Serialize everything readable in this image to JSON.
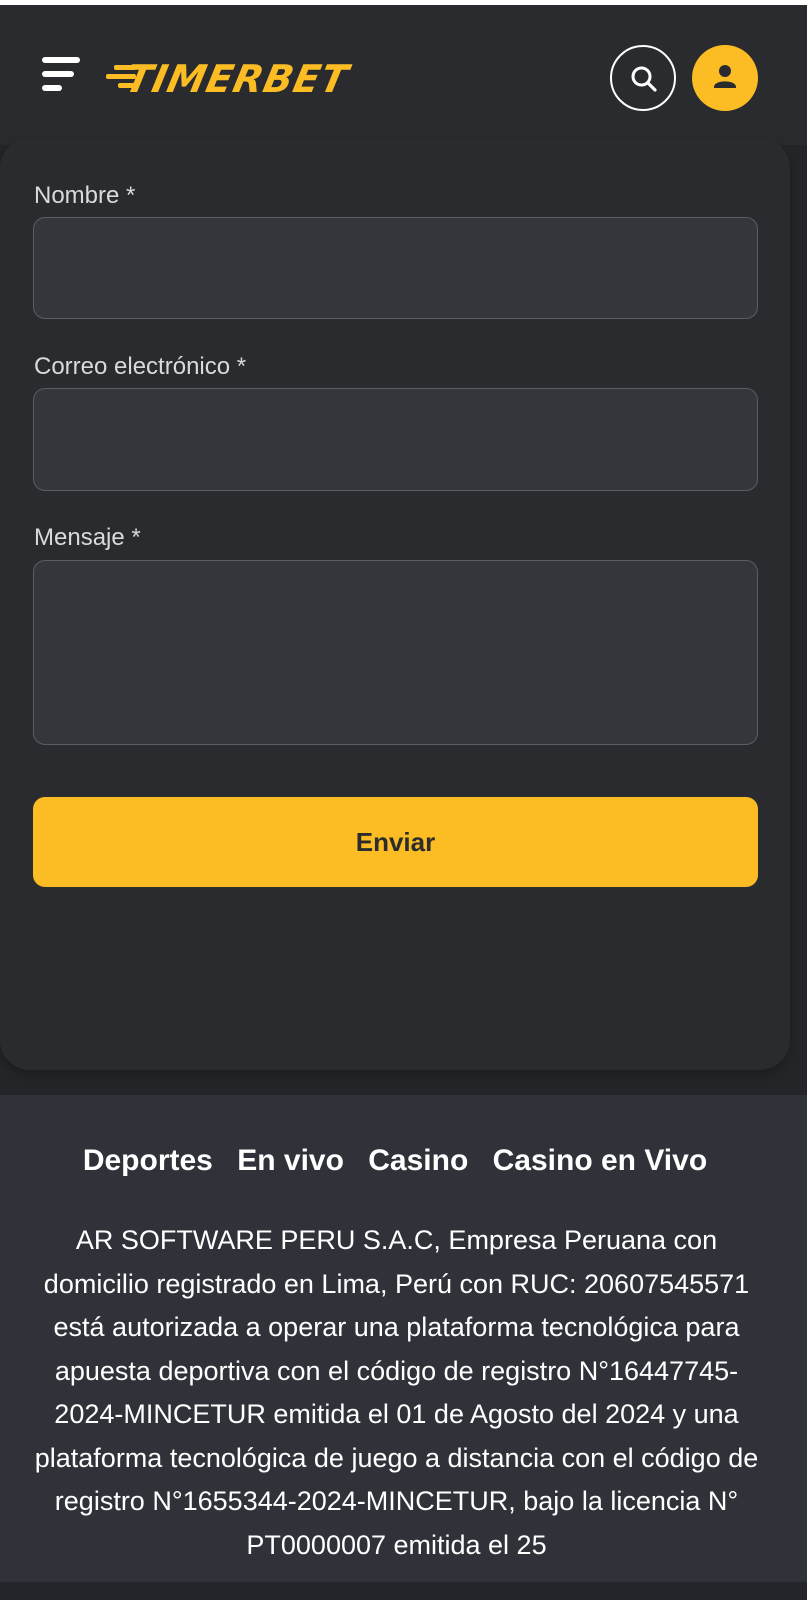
{
  "header": {
    "brand": "TIMERBET",
    "search_icon": "search-icon",
    "user_icon": "user-icon",
    "menu_icon": "hamburger-icon"
  },
  "form": {
    "name_label": "Nombre *",
    "name_value": "",
    "email_label": "Correo electrónico *",
    "email_value": "",
    "message_label": "Mensaje *",
    "message_value": "",
    "submit_label": "Enviar"
  },
  "footer": {
    "links": [
      "Deportes",
      "En vivo",
      "Casino",
      "Casino en Vivo"
    ],
    "legal_text": "AR SOFTWARE PERU S.A.C, Empresa Peruana con domicilio registrado en Lima, Perú con RUC: 20607545571 está autorizada a operar una plataforma tecnológica para apuesta deportiva con el código de registro N°16447745-2024-MINCETUR emitida el 01 de Agosto del 2024 y una plataforma tecnológica de juego a distancia con el código de registro N°1655344-2024-MINCETUR, bajo la licencia N° PT0000007 emitida el 25"
  },
  "colors": {
    "accent": "#fbbd23",
    "background": "#232529",
    "card": "#2a2b2f",
    "footer": "#2f3339",
    "input": "#34363b"
  }
}
